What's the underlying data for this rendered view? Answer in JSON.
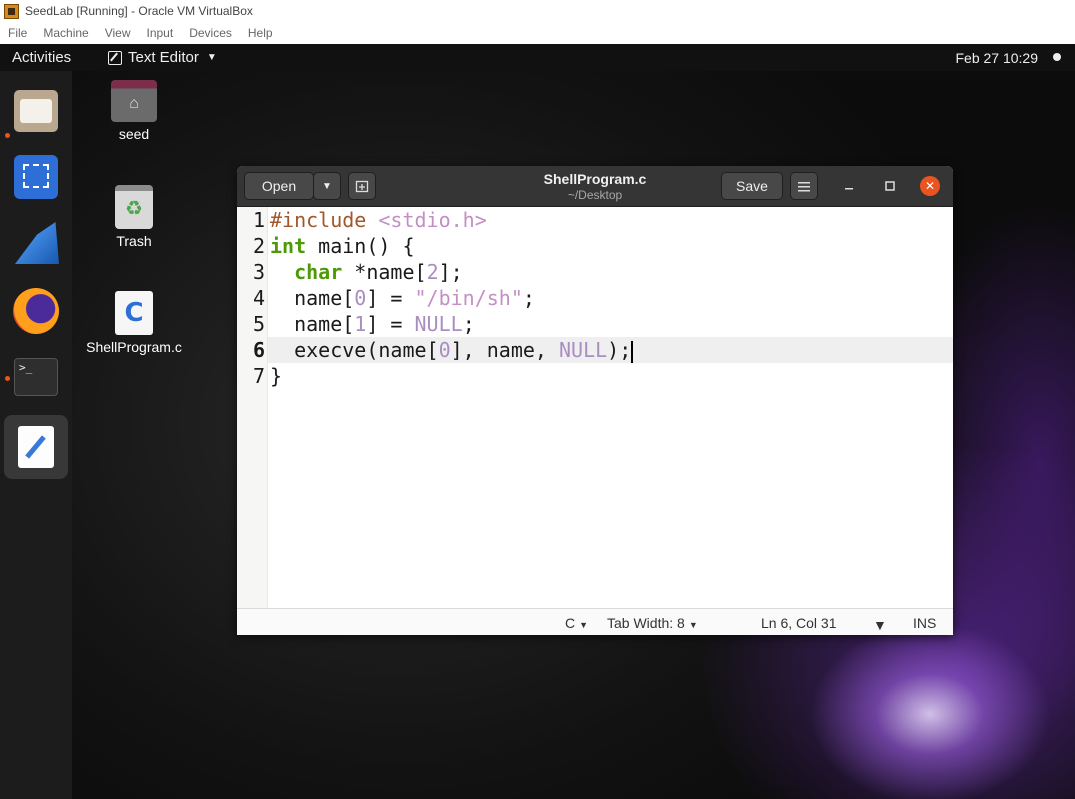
{
  "host": {
    "title": "SeedLab [Running] - Oracle VM VirtualBox",
    "menu": [
      "File",
      "Machine",
      "View",
      "Input",
      "Devices",
      "Help"
    ]
  },
  "topbar": {
    "activities": "Activities",
    "app_name": "Text Editor",
    "clock": "Feb 27  10:29"
  },
  "dock": {
    "items": [
      {
        "name": "files-icon",
        "running": true
      },
      {
        "name": "screenshot-icon",
        "running": false
      },
      {
        "name": "wireshark-icon",
        "running": false
      },
      {
        "name": "firefox-icon",
        "running": false
      },
      {
        "name": "terminal-icon",
        "running": true,
        "text": ">_"
      },
      {
        "name": "text-editor-icon",
        "running": true,
        "active": true
      }
    ]
  },
  "desktop": {
    "icons": [
      {
        "label": "seed"
      },
      {
        "label": "Trash"
      },
      {
        "label": "ShellProgram.c",
        "glyph": "C"
      }
    ]
  },
  "editor": {
    "open_label": "Open",
    "save_label": "Save",
    "title": "ShellProgram.c",
    "path": "~/Desktop",
    "current_line": 6,
    "line_numbers": [
      "1",
      "2",
      "3",
      "4",
      "5",
      "6",
      "7"
    ],
    "lines": [
      "#include <stdio.h>",
      "int main() {",
      "  char *name[2];",
      "  name[0] = \"/bin/sh\";",
      "  name[1] = NULL;",
      "  execve(name[0], name, NULL);",
      "}"
    ]
  },
  "status": {
    "language": "C",
    "tab_width": "Tab Width: 8",
    "position": "Ln 6, Col 31",
    "mode": "INS"
  },
  "colors": {
    "accent": "#e95420",
    "keyword": "#4e9a06",
    "preprocessor": "#a1572b",
    "string": "#c48fc4",
    "number": "#a98fc0"
  }
}
